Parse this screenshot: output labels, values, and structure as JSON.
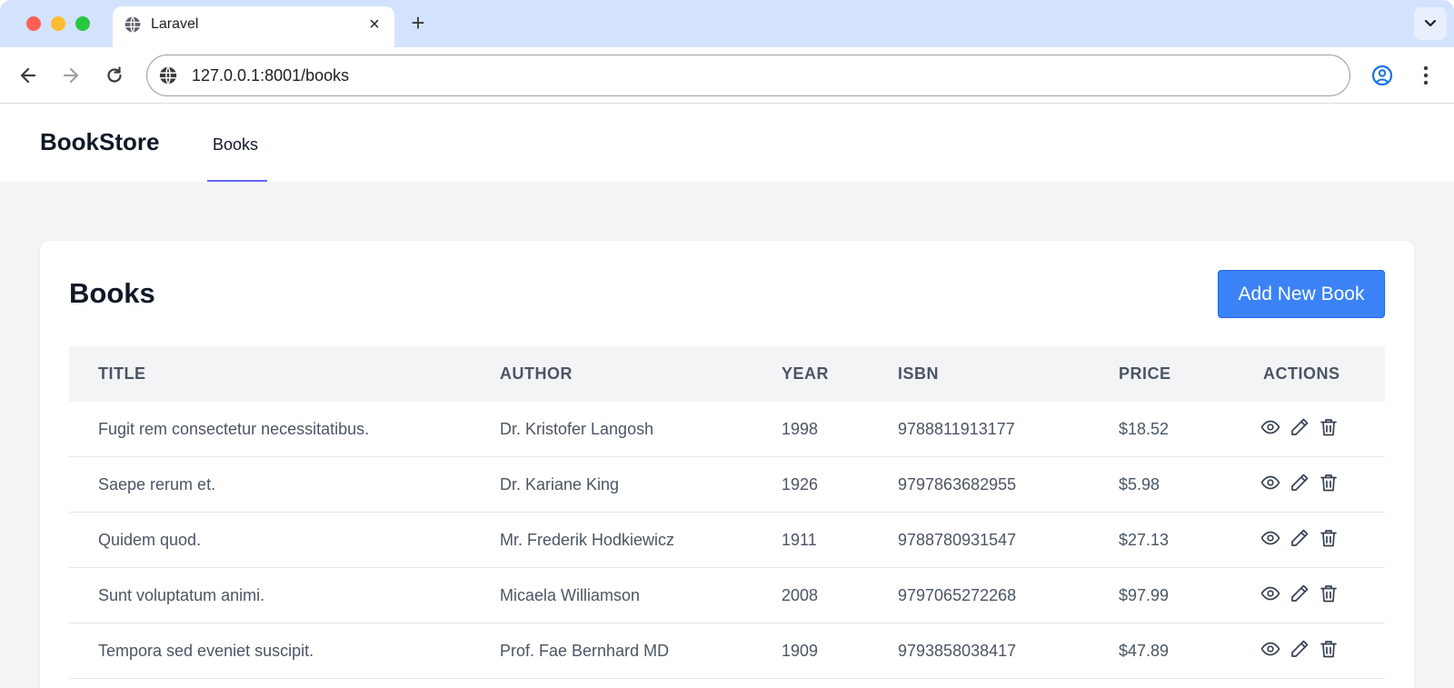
{
  "browser": {
    "tab_title": "Laravel",
    "tab_close": "×",
    "new_tab": "+",
    "url": "127.0.0.1:8001/books"
  },
  "navbar": {
    "brand": "BookStore",
    "links": [
      {
        "label": "Books",
        "active": true
      }
    ],
    "active_color": "#6366f1"
  },
  "page": {
    "title": "Books",
    "add_button": "Add New Book",
    "accent_color": "#3b82f6"
  },
  "table": {
    "columns": [
      "TITLE",
      "AUTHOR",
      "YEAR",
      "ISBN",
      "PRICE",
      "ACTIONS"
    ],
    "rows": [
      {
        "title": "Fugit rem consectetur necessitatibus.",
        "author": "Dr. Kristofer Langosh",
        "year": "1998",
        "isbn": "9788811913177",
        "price": "$18.52"
      },
      {
        "title": "Saepe rerum et.",
        "author": "Dr. Kariane King",
        "year": "1926",
        "isbn": "9797863682955",
        "price": "$5.98"
      },
      {
        "title": "Quidem quod.",
        "author": "Mr. Frederik Hodkiewicz",
        "year": "1911",
        "isbn": "9788780931547",
        "price": "$27.13"
      },
      {
        "title": "Sunt voluptatum animi.",
        "author": "Micaela Williamson",
        "year": "2008",
        "isbn": "9797065272268",
        "price": "$97.99"
      },
      {
        "title": "Tempora sed eveniet suscipit.",
        "author": "Prof. Fae Bernhard MD",
        "year": "1909",
        "isbn": "9793858038417",
        "price": "$47.89"
      }
    ],
    "row_actions": [
      "eye-icon",
      "pencil-icon",
      "trash-icon"
    ]
  }
}
